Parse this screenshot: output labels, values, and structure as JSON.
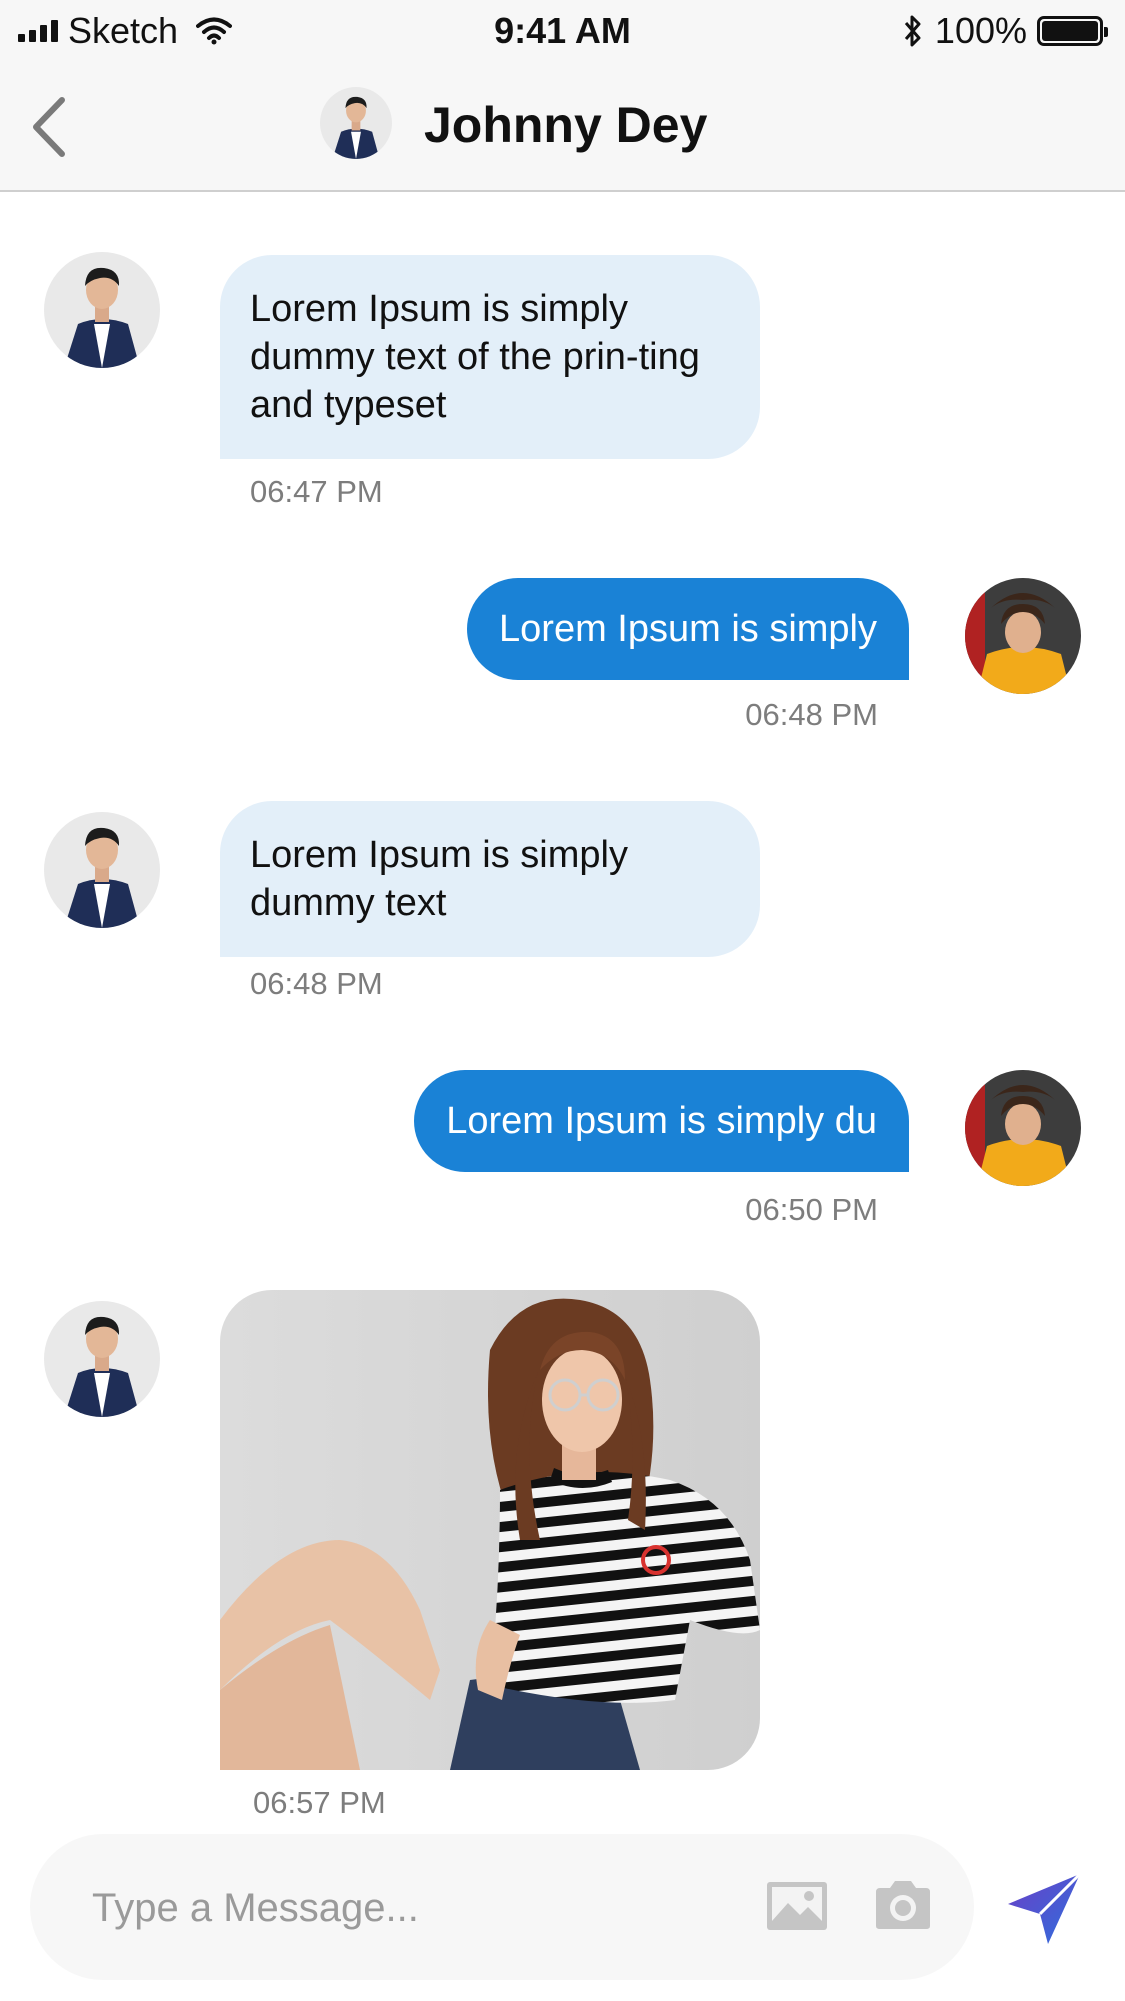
{
  "status_bar": {
    "carrier": "Sketch",
    "time": "9:41 AM",
    "battery": "100%"
  },
  "header": {
    "contact_name": "Johnny Dey",
    "back_icon": "chevron-left-icon"
  },
  "messages": [
    {
      "direction": "incoming",
      "text": "Lorem Ipsum is simply dummy text of the prin-ting and typeset",
      "time": "06:47 PM"
    },
    {
      "direction": "outgoing",
      "text": "Lorem Ipsum is simply",
      "time": "06:48 PM"
    },
    {
      "direction": "incoming",
      "text": "Lorem Ipsum is simply dummy text",
      "time": "06:48 PM"
    },
    {
      "direction": "outgoing",
      "text": "Lorem Ipsum is simply du",
      "time": "06:50 PM"
    },
    {
      "direction": "incoming",
      "type": "image",
      "image": "photo of a woman in striped t-shirt",
      "time": "06:57 PM"
    }
  ],
  "composer": {
    "placeholder": "Type a Message...",
    "value": "",
    "icons": [
      "image-icon",
      "camera-icon",
      "send-icon"
    ]
  },
  "colors": {
    "incoming_bubble": "#e3eff9",
    "outgoing_bubble": "#1a82d6",
    "timestamp": "#7d7d7d",
    "send_accent": "#6a3fc7"
  }
}
